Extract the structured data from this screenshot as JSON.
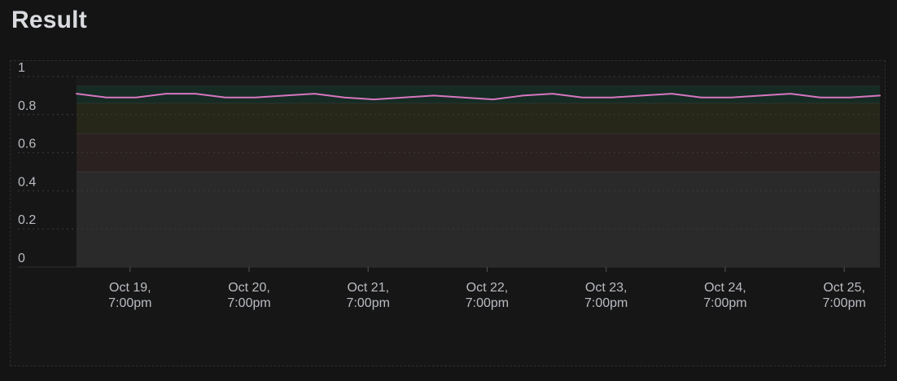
{
  "page": {
    "title": "Result"
  },
  "chart_data": {
    "type": "line",
    "title": "",
    "xlabel": "",
    "ylabel": "",
    "ylim": [
      0,
      1
    ],
    "yticks": [
      "0",
      "0.2",
      "0.4",
      "0.6",
      "0.8",
      "1"
    ],
    "xticks": [
      {
        "line1": "Oct 19,",
        "line2": "7:00pm",
        "t": 0.45
      },
      {
        "line1": "Oct 20,",
        "line2": "7:00pm",
        "t": 1.45
      },
      {
        "line1": "Oct 21,",
        "line2": "7:00pm",
        "t": 2.45
      },
      {
        "line1": "Oct 22,",
        "line2": "7:00pm",
        "t": 3.45
      },
      {
        "line1": "Oct 23,",
        "line2": "7:00pm",
        "t": 4.45
      },
      {
        "line1": "Oct 24,",
        "line2": "7:00pm",
        "t": 5.45
      },
      {
        "line1": "Oct 25,",
        "line2": "7:00pm",
        "t": 6.45
      }
    ],
    "xlim": [
      0,
      6.75
    ],
    "grid": true,
    "bands": [
      {
        "from": 0,
        "to": 0.5,
        "color": "#2a2a2a"
      },
      {
        "from": 0.5,
        "to": 0.7,
        "color": "#2b2120"
      },
      {
        "from": 0.7,
        "to": 0.86,
        "color": "#262619"
      },
      {
        "from": 0.86,
        "to": 0.95,
        "color": "#162b24"
      },
      {
        "from": 0.95,
        "to": 1.0,
        "color": "#1a1a1a"
      }
    ],
    "series": [
      {
        "color": "#d776c0",
        "x": [
          0,
          0.25,
          0.5,
          0.75,
          1.0,
          1.25,
          1.5,
          1.75,
          2.0,
          2.25,
          2.5,
          2.75,
          3.0,
          3.25,
          3.5,
          3.75,
          4.0,
          4.25,
          4.5,
          4.75,
          5.0,
          5.25,
          5.5,
          5.75,
          6.0,
          6.25,
          6.5,
          6.75
        ],
        "values": [
          0.91,
          0.89,
          0.89,
          0.91,
          0.91,
          0.89,
          0.89,
          0.9,
          0.91,
          0.89,
          0.88,
          0.89,
          0.9,
          0.89,
          0.88,
          0.9,
          0.91,
          0.89,
          0.89,
          0.9,
          0.91,
          0.89,
          0.89,
          0.9,
          0.91,
          0.89,
          0.89,
          0.9
        ]
      }
    ]
  }
}
